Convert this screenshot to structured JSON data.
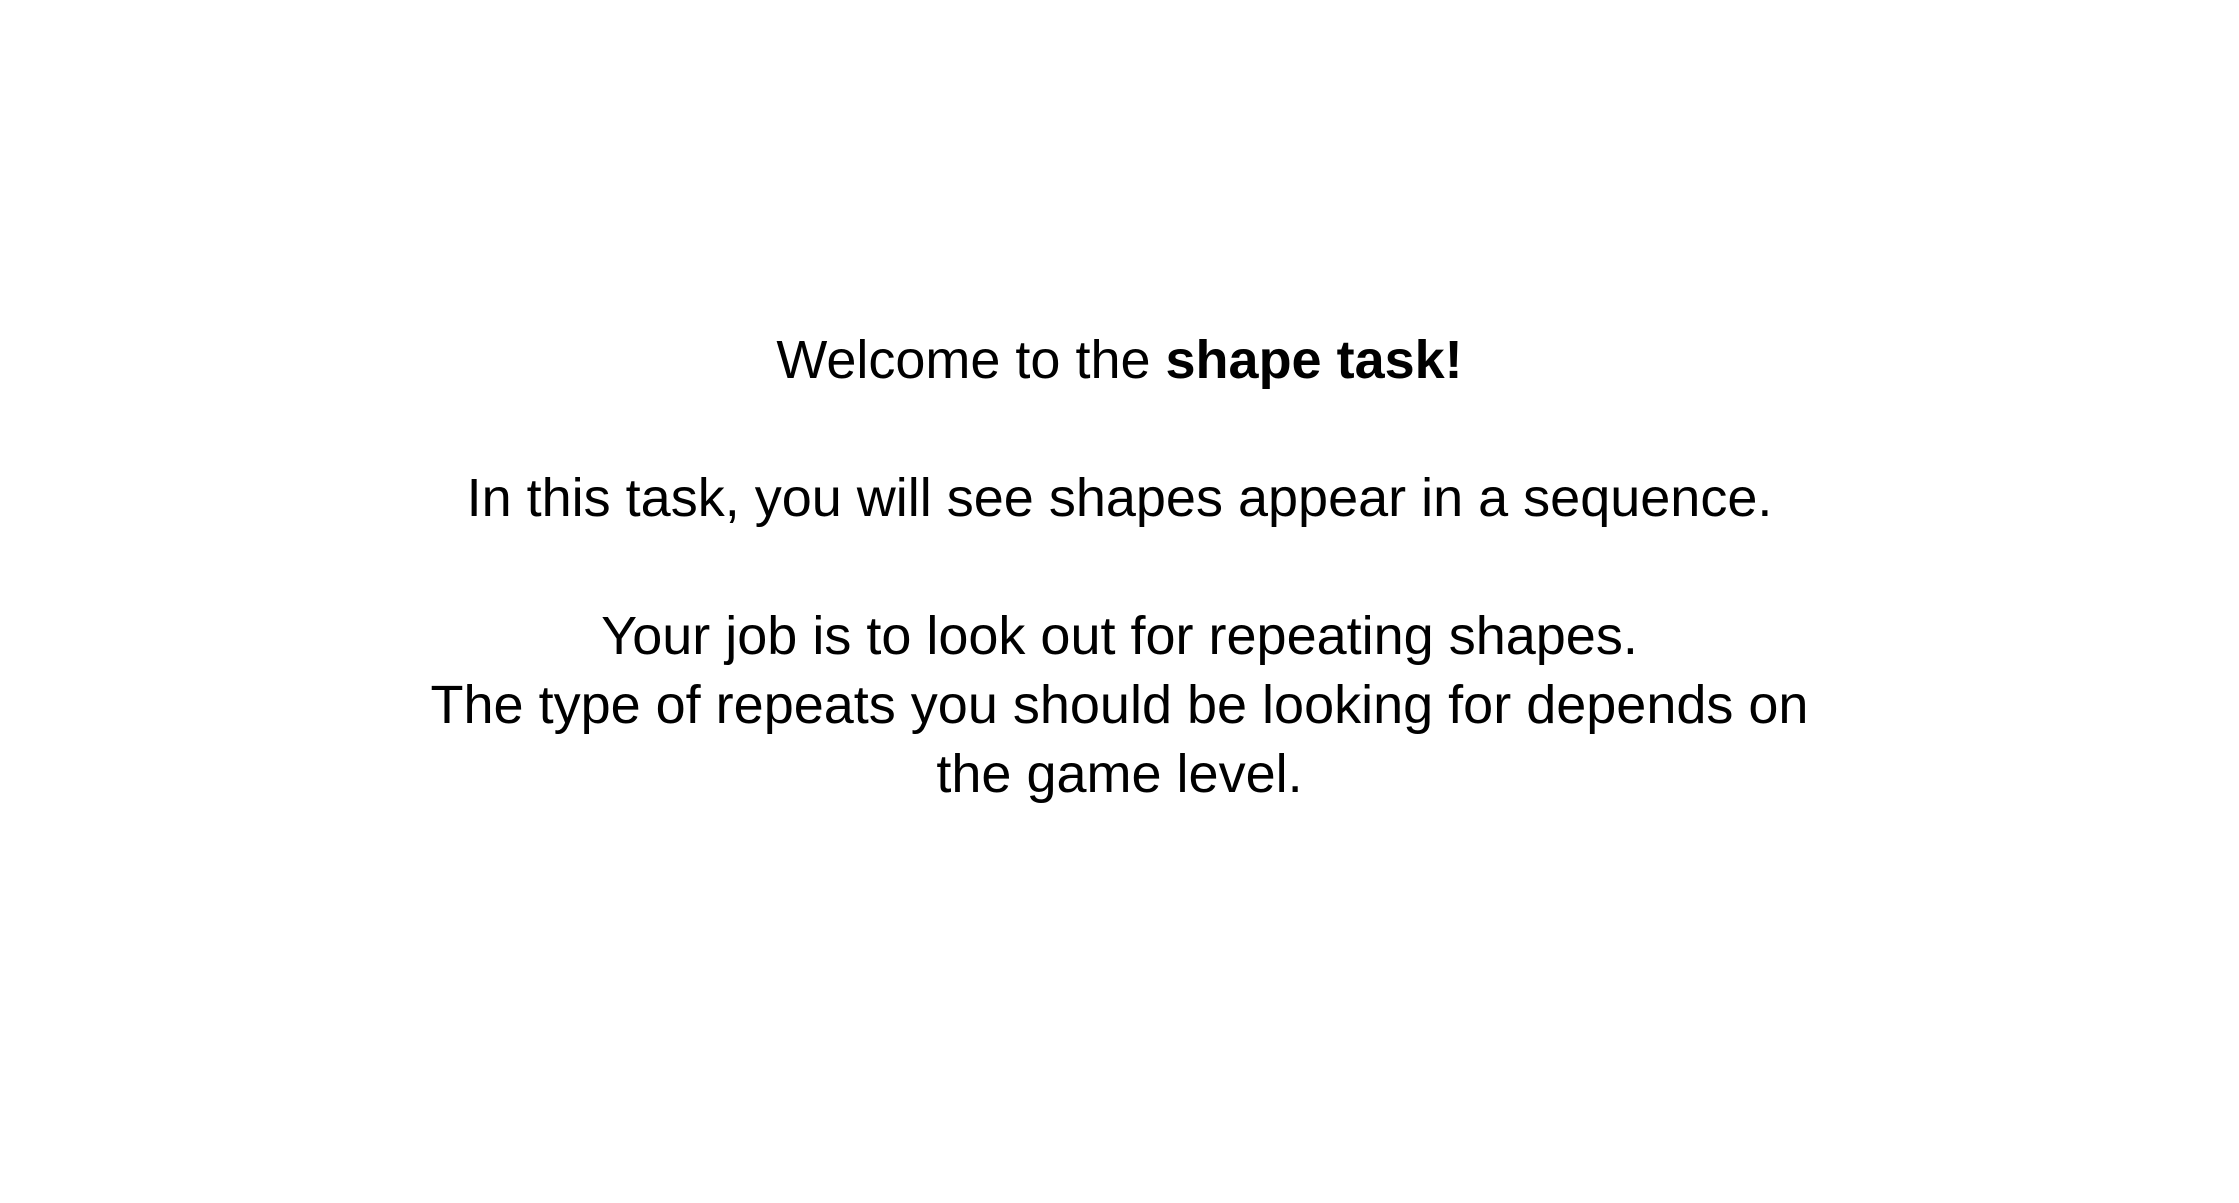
{
  "welcome": {
    "prefix": "Welcome to the ",
    "emphasis": "shape task!"
  },
  "intro": "In this task, you will see shapes appear in a sequence.",
  "job": {
    "line1": "Your job is to look out for repeating shapes.",
    "line2": "The type of repeats you should be looking for depends on",
    "line3": "the game level."
  }
}
